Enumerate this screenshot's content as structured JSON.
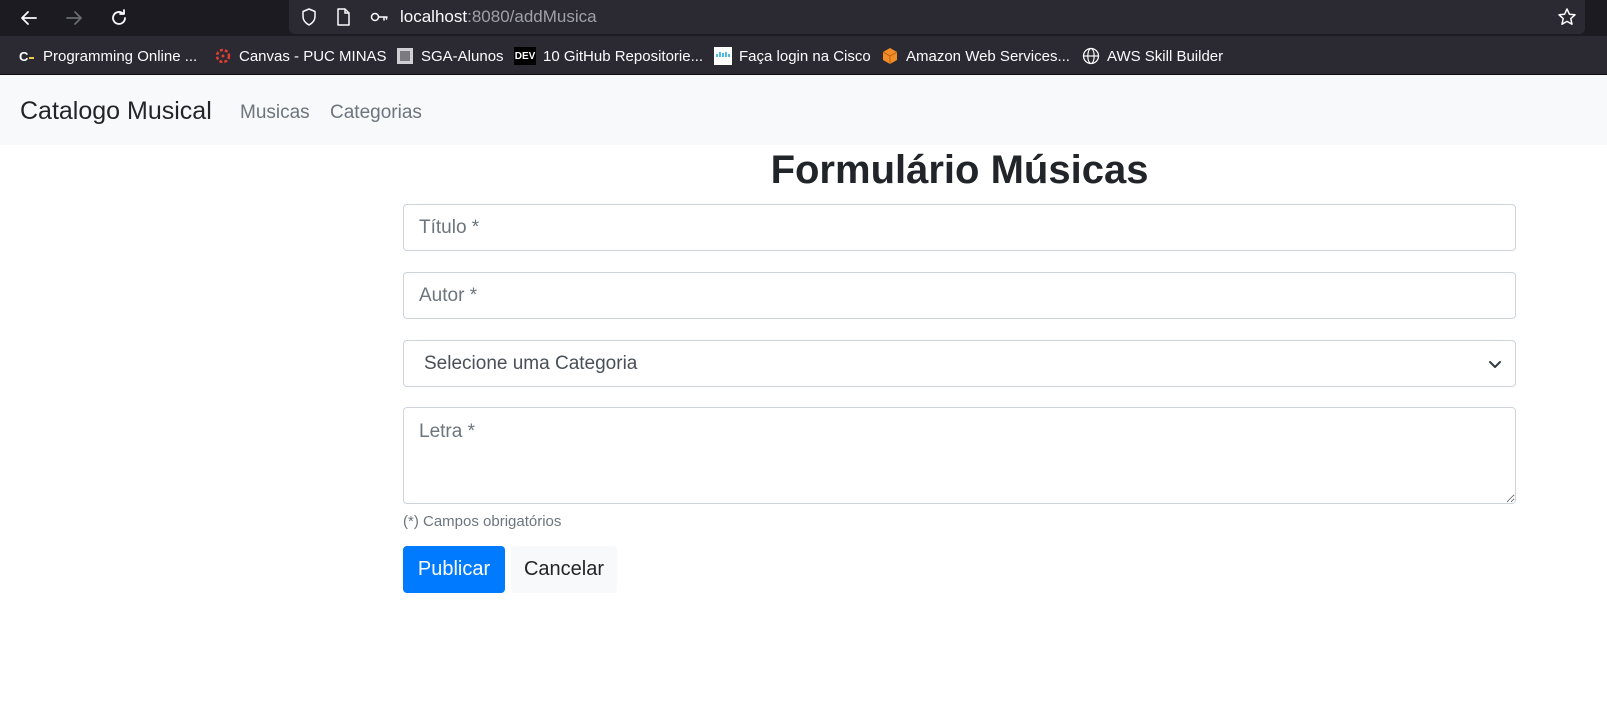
{
  "browser": {
    "url_host": "localhost",
    "url_path": ":8080/addMusica",
    "bookmarks": [
      {
        "label": "Programming Online ...",
        "icon": "programiz-icon"
      },
      {
        "label": "Canvas - PUC MINAS",
        "icon": "canvas-icon"
      },
      {
        "label": "SGA-Alunos",
        "icon": "sga-icon"
      },
      {
        "label": "10 GitHub Repositorie...",
        "icon": "dev-icon",
        "icon_text": "DEV"
      },
      {
        "label": "Faça login na Cisco",
        "icon": "cisco-icon"
      },
      {
        "label": "Amazon Web Services...",
        "icon": "aws-icon"
      },
      {
        "label": "AWS Skill Builder",
        "icon": "globe-icon"
      }
    ]
  },
  "navbar": {
    "brand": "Catalogo Musical",
    "links": [
      "Musicas",
      "Categorias"
    ]
  },
  "form": {
    "title": "Formulário Músicas",
    "titulo_placeholder": "Título *",
    "autor_placeholder": "Autor *",
    "categoria_selected": "Selecione uma Categoria",
    "letra_placeholder": "Letra *",
    "help": "(*) Campos obrigatórios",
    "submit_label": "Publicar",
    "cancel_label": "Cancelar"
  },
  "colors": {
    "primary": "#007bff",
    "navbar_bg": "#f8f9fa",
    "browser_bg": "#1c1b22"
  }
}
